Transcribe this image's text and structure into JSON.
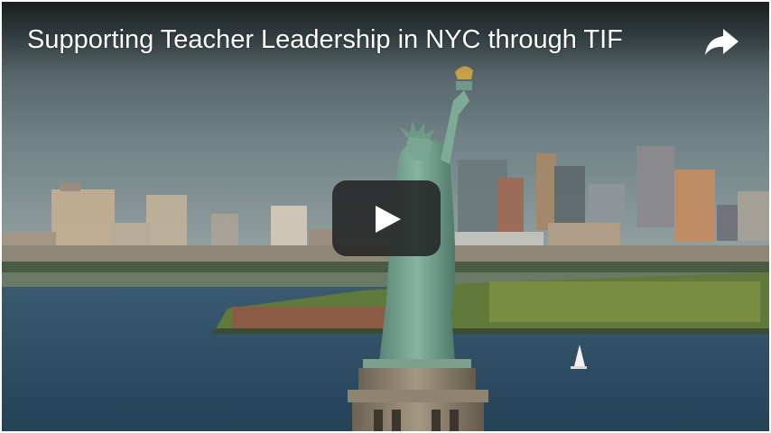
{
  "video": {
    "title": "Supporting Teacher Leadership in NYC through TIF",
    "share_icon": "share-arrow-icon",
    "play_icon": "play-icon"
  },
  "colors": {
    "sky_top": "#3d4a4f",
    "sky_bottom": "#8f9fa1",
    "water": "#2f5069",
    "statue": "#6f9b8a",
    "play_bg": "#212121"
  }
}
